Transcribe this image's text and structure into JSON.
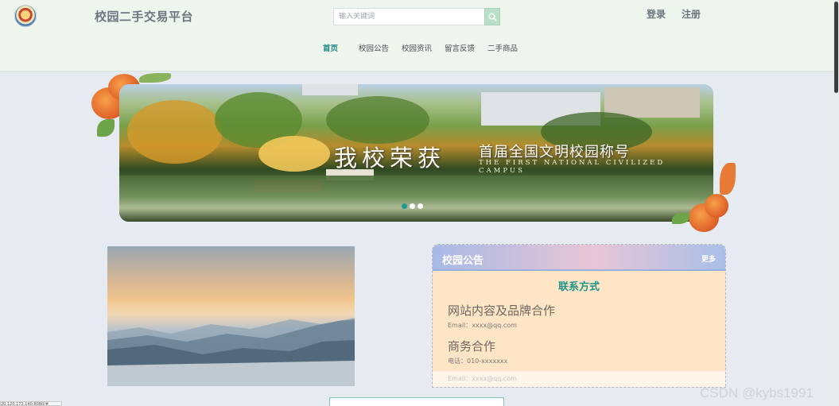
{
  "header": {
    "site_title": "校园二手交易平台",
    "search_placeholder": "输入关键词",
    "login": "登录",
    "register": "注册",
    "logo_icon": "campus-logo-icon",
    "search_icon": "search-icon"
  },
  "nav": {
    "items": [
      {
        "label": "首页",
        "active": true
      },
      {
        "label": "校园公告",
        "active": false
      },
      {
        "label": "校园资讯",
        "active": false
      },
      {
        "label": "留言反馈",
        "active": false
      },
      {
        "label": "二手商品",
        "active": false
      }
    ]
  },
  "banner": {
    "title_cn": "我校荣获",
    "title_sub": "首届全国文明校园称号",
    "title_en": "THE FIRST NATIONAL CIVILIZED CAMPUS",
    "slide_count": 3,
    "active_slide": 0
  },
  "notice": {
    "title": "校园公告",
    "more": "更多",
    "contact_title": "联系方式",
    "blocks": [
      {
        "heading": "网站内容及品牌合作",
        "line": "Email：xxxx@qq.com"
      },
      {
        "heading": "商务合作",
        "line": "电话：010-xxxxxxx"
      }
    ],
    "faded_line": "Email：xxxx@qq.com"
  },
  "watermark": "CSDN @kybs1991",
  "status_url": "20.120.172.140:8080/#",
  "colors": {
    "accent": "#1f8a86",
    "header_bg": "#eef5ec",
    "page_bg": "#e6ebf1",
    "card_bg": "#fde5c6"
  }
}
